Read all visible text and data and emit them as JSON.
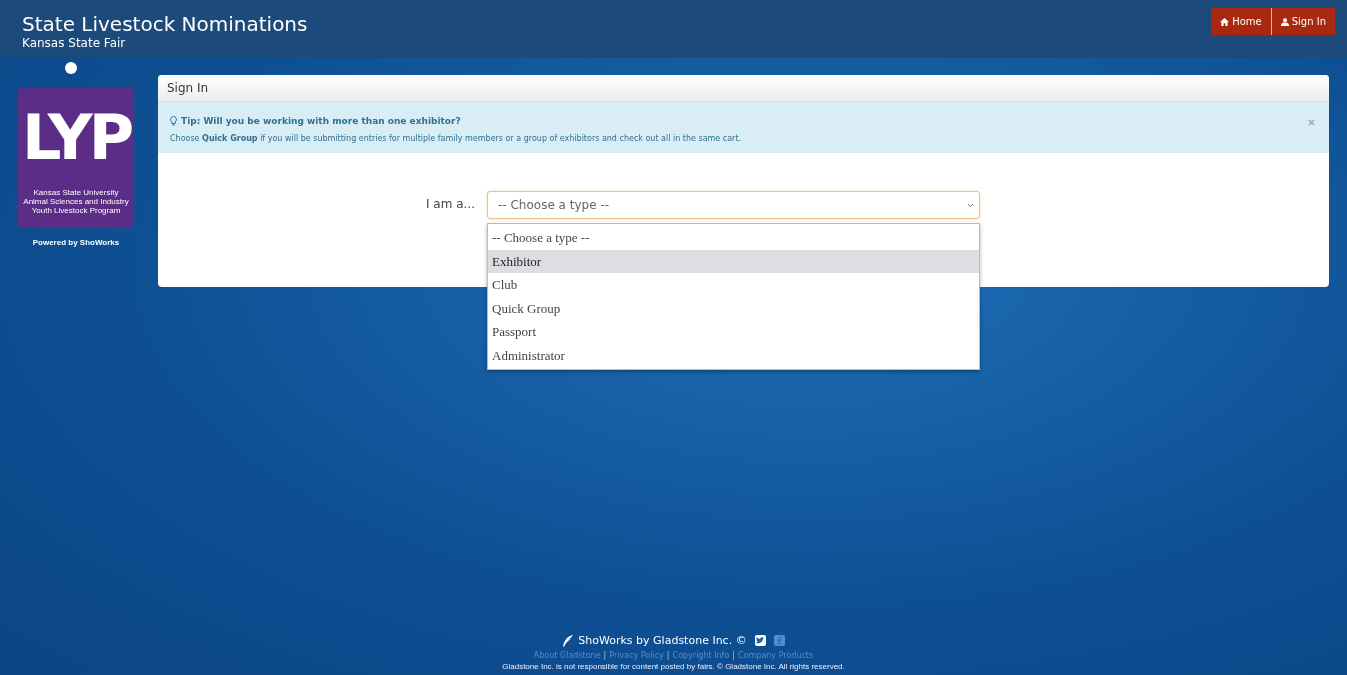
{
  "header": {
    "title": "State Livestock Nominations",
    "subtitle": "Kansas State Fair"
  },
  "nav": [
    {
      "kind": "home",
      "label": "Home"
    },
    {
      "kind": "user",
      "label": "Sign In"
    }
  ],
  "sidebar": {
    "logo_text": "LYP",
    "logo_caption": [
      "Kansas State University",
      "Animal Sciences and Industry",
      "Youth Livestock Program"
    ],
    "powered": "Powered by ShoWorks"
  },
  "panel": {
    "title": "Sign In",
    "tip": {
      "heading": "Tip: Will you be working with more than one exhibitor?",
      "text": "Choose **Quick Group** if you will be submitting entries for multiple family members or a group of exhibitors and check out all in the same cart."
    },
    "field_label": "I am a...",
    "select_value": "-- Choose a type --",
    "options": [
      {
        "label": "-- Choose a type --",
        "selected": false
      },
      {
        "label": "Exhibitor",
        "selected": true
      },
      {
        "label": "Club",
        "selected": false
      },
      {
        "label": "Quick Group",
        "selected": false
      },
      {
        "label": "Passport",
        "selected": false
      },
      {
        "label": "Administrator",
        "selected": false
      }
    ]
  },
  "footer": {
    "brand": "ShoWorks by Gladstone Inc. ©",
    "separator": "|",
    "links": [
      "About Gladstone",
      "Privacy Policy",
      "Copyright Info",
      "Company Products"
    ],
    "disclaimer": "Gladstone Inc. is not responsible for content posted by fairs. © Gladstone Inc. All rights reserved."
  }
}
